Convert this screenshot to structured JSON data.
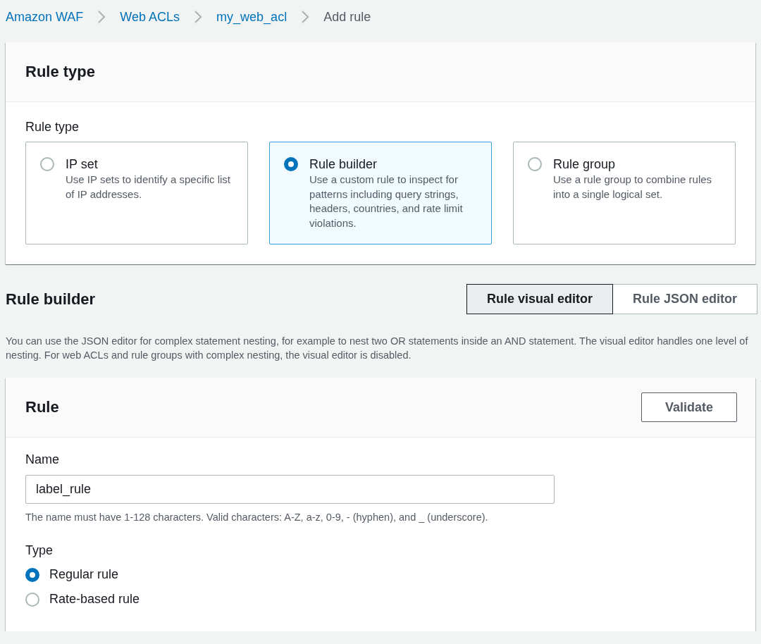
{
  "breadcrumbs": [
    {
      "label": "Amazon WAF",
      "current": false
    },
    {
      "label": "Web ACLs",
      "current": false
    },
    {
      "label": "my_web_acl",
      "current": false
    },
    {
      "label": "Add rule",
      "current": true
    }
  ],
  "rule_type_panel": {
    "title": "Rule type",
    "field_label": "Rule type",
    "options": [
      {
        "title": "IP set",
        "description": "Use IP sets to identify a specific list of IP addresses.",
        "selected": false
      },
      {
        "title": "Rule builder",
        "description": "Use a custom rule to inspect for patterns including query strings, headers, countries, and rate limit violations.",
        "selected": true
      },
      {
        "title": "Rule group",
        "description": "Use a rule group to combine rules into a single logical set.",
        "selected": false
      }
    ]
  },
  "rule_builder": {
    "title": "Rule builder",
    "editor_tabs": [
      {
        "label": "Rule visual editor",
        "selected": true
      },
      {
        "label": "Rule JSON editor",
        "selected": false
      }
    ],
    "description": "You can use the JSON editor for complex statement nesting, for example to nest two OR statements inside an AND statement. The visual editor handles one level of nesting. For web ACLs and rule groups with complex nesting, the visual editor is disabled."
  },
  "rule_panel": {
    "title": "Rule",
    "validate_button": "Validate",
    "name_field": {
      "label": "Name",
      "value": "label_rule",
      "hint": "The name must have 1-128 characters. Valid characters: A-Z, a-z, 0-9, - (hyphen), and _ (underscore)."
    },
    "type_field": {
      "label": "Type",
      "options": [
        {
          "label": "Regular rule",
          "selected": true
        },
        {
          "label": "Rate-based rule",
          "selected": false
        }
      ]
    }
  }
}
